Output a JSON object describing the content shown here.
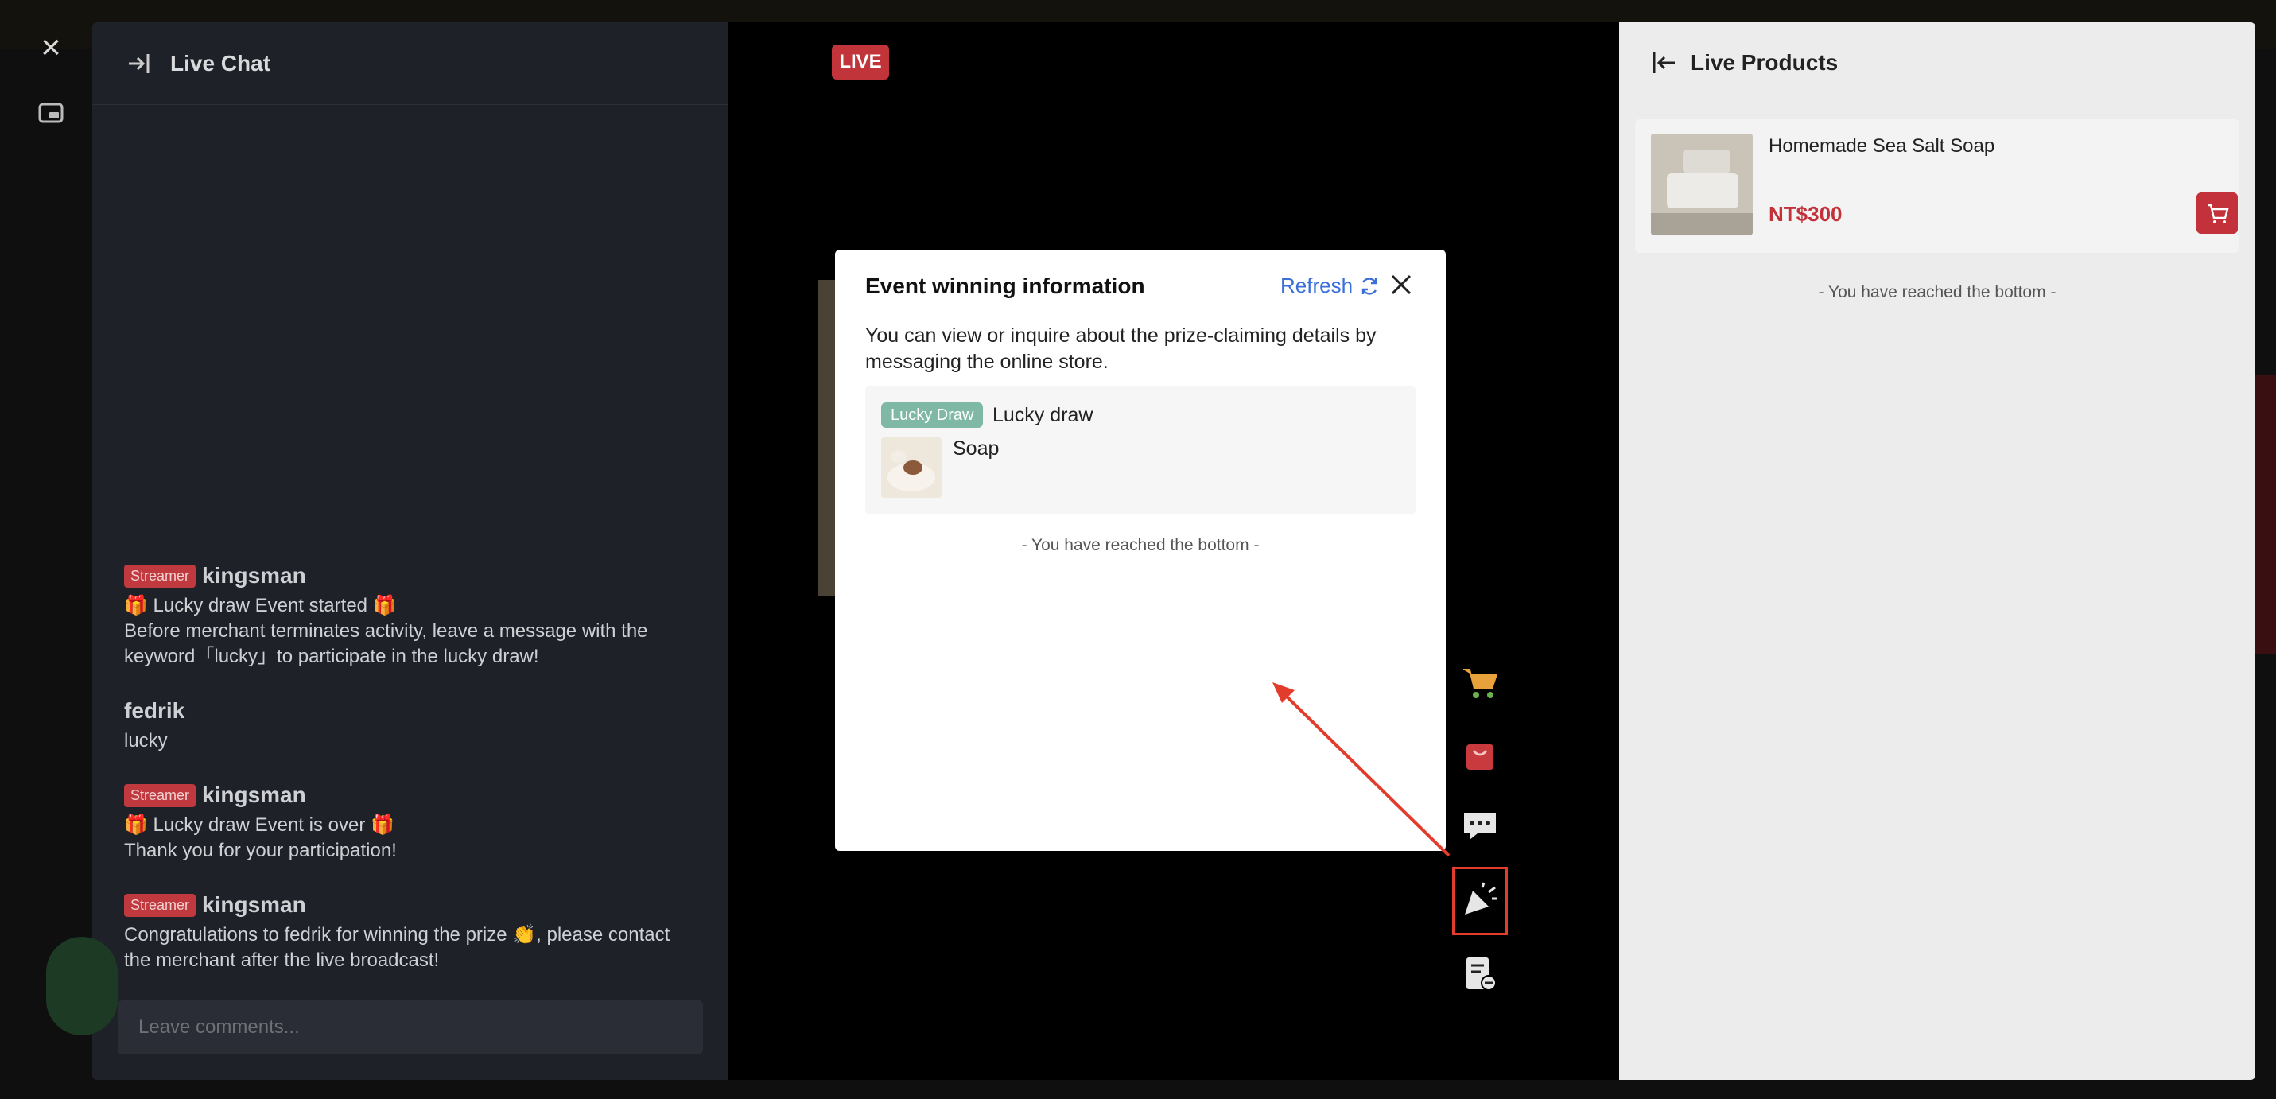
{
  "chat": {
    "title": "Live Chat",
    "input_placeholder": "Leave comments...",
    "messages": [
      {
        "badge": "Streamer",
        "author": "kingsman",
        "lines": [
          "🎁 Lucky draw Event started 🎁",
          "Before merchant terminates activity, leave a message with the",
          "keyword「lucky」to participate in the lucky draw!"
        ]
      },
      {
        "badge": "",
        "author": "fedrik",
        "lines": [
          "lucky"
        ]
      },
      {
        "badge": "Streamer",
        "author": "kingsman",
        "lines": [
          "🎁 Lucky draw Event is over 🎁",
          "Thank you for your participation!"
        ]
      },
      {
        "badge": "Streamer",
        "author": "kingsman",
        "lines": [
          "Congratulations to fedrik for winning the prize 👏, please contact",
          "the merchant after the live broadcast!"
        ]
      }
    ]
  },
  "video": {
    "live_label": "LIVE"
  },
  "modal": {
    "title": "Event winning information",
    "refresh_label": "Refresh",
    "description": "You can view or inquire about the prize-claiming details by messaging the online store.",
    "winning": {
      "tag": "Lucky Draw",
      "event_name": "Lucky draw",
      "prize": "Soap"
    },
    "bottom_text": "- You have reached the bottom -"
  },
  "products": {
    "title": "Live Products",
    "items": [
      {
        "name": "Homemade Sea Salt Soap",
        "price": "NT$300"
      }
    ],
    "bottom_text": "- You have reached the bottom -"
  },
  "side_actions": [
    "cart-icon",
    "shopping-bag-icon",
    "chat-bubble-icon",
    "party-popper-icon",
    "receipt-icon"
  ],
  "colors": {
    "live_red": "#c0343a",
    "price_red": "#c3323a",
    "link_blue": "#3a6fd8",
    "highlight_red": "#e23c2c",
    "tag_green": "#7fb9a6"
  }
}
